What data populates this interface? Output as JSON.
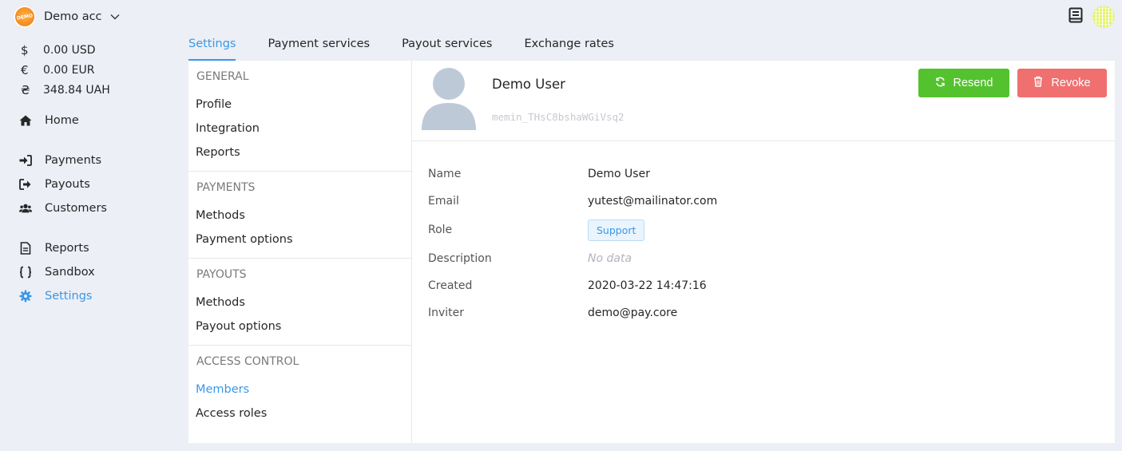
{
  "account": {
    "logo_text": "DEMO",
    "name": "Demo acc"
  },
  "balances": [
    {
      "symbol": "$",
      "value": "0.00 USD"
    },
    {
      "symbol": "€",
      "value": "0.00 EUR"
    },
    {
      "symbol": "₴",
      "value": "348.84 UAH"
    }
  ],
  "nav": {
    "home": "Home",
    "payments": "Payments",
    "payouts": "Payouts",
    "customers": "Customers",
    "reports": "Reports",
    "sandbox": "Sandbox",
    "settings": "Settings"
  },
  "tabs": [
    "Settings",
    "Payment services",
    "Payout services",
    "Exchange rates"
  ],
  "submenu": {
    "general": {
      "title": "GENERAL",
      "items": [
        "Profile",
        "Integration",
        "Reports"
      ]
    },
    "payments": {
      "title": "PAYMENTS",
      "items": [
        "Methods",
        "Payment options"
      ]
    },
    "payouts": {
      "title": "PAYOUTS",
      "items": [
        "Methods",
        "Payout options"
      ]
    },
    "access": {
      "title": "ACCESS CONTROL",
      "items": [
        "Members",
        "Access roles"
      ]
    }
  },
  "user": {
    "name": "Demo User",
    "id": "memin_THsC8bshaWGiVsq2",
    "resend_label": "Resend",
    "revoke_label": "Revoke"
  },
  "details": {
    "name_label": "Name",
    "name_value": "Demo User",
    "email_label": "Email",
    "email_value": "yutest@mailinator.com",
    "role_label": "Role",
    "role_value": "Support",
    "description_label": "Description",
    "description_value": "No data",
    "created_label": "Created",
    "created_value": "2020-03-22 14:47:16",
    "inviter_label": "Inviter",
    "inviter_value": "demo@pay.core"
  },
  "colors": {
    "accent": "#3b97e8",
    "resend": "#54c22f",
    "revoke": "#f07070",
    "background": "#eceff6"
  }
}
